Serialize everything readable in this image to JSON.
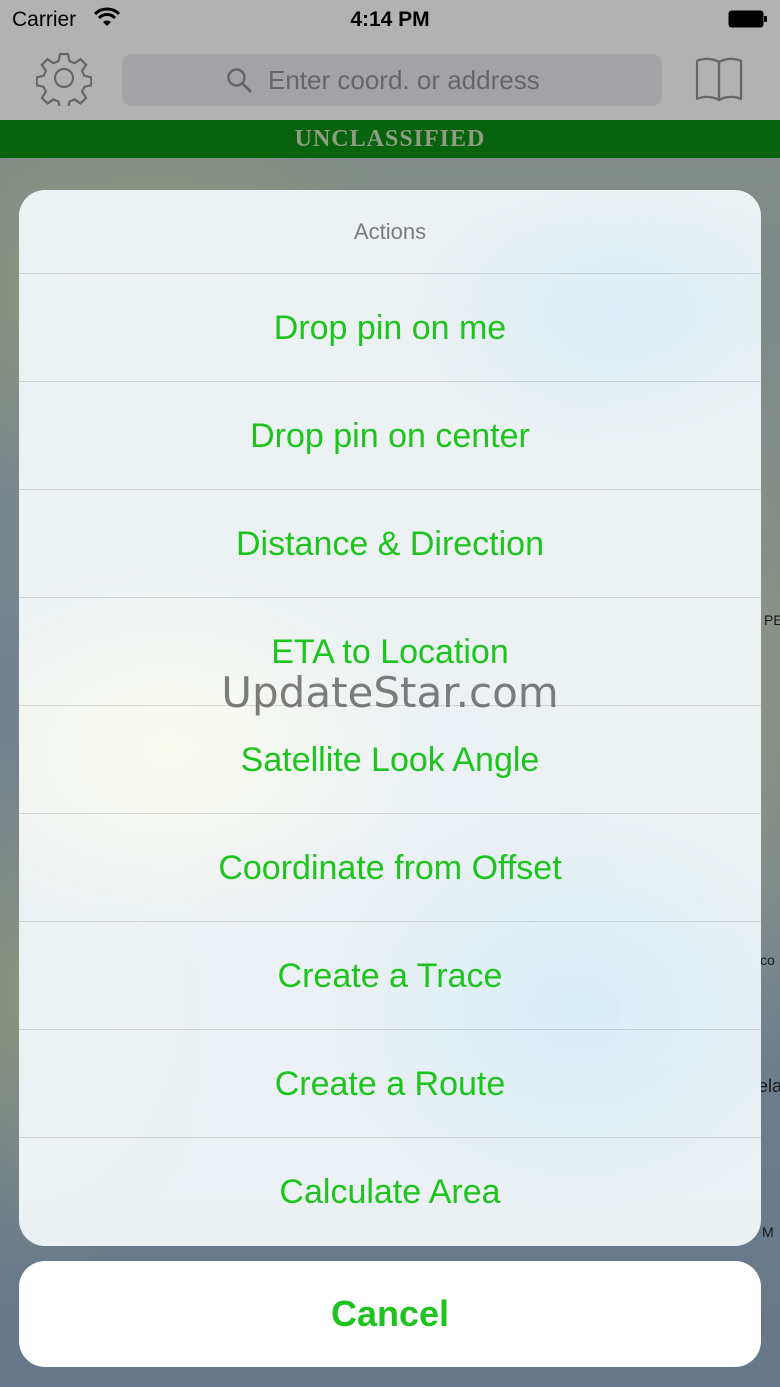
{
  "status_bar": {
    "carrier": "Carrier",
    "time": "4:14 PM",
    "wifi_icon": "wifi-icon",
    "battery_icon": "battery-full-icon"
  },
  "toolbar": {
    "settings_icon": "gear-icon",
    "search_icon": "magnifier-icon",
    "search_placeholder": "Enter coord. or address",
    "search_value": "",
    "bookmarks_icon": "book-icon"
  },
  "banner": {
    "text": "UNCLASSIFIED",
    "background": "#0a8a12",
    "text_color": "#c6d9b4"
  },
  "map": {
    "edge_labels": [
      "PE",
      "co",
      "ela",
      "M"
    ]
  },
  "action_sheet": {
    "title": "Actions",
    "accent_color": "#1ec41e",
    "actions": [
      "Drop pin on me",
      "Drop pin on center",
      "Distance & Direction",
      "ETA to Location",
      "Satellite Look Angle",
      "Coordinate from Offset",
      "Create a Trace",
      "Create a Route",
      "Calculate Area"
    ]
  },
  "cancel": {
    "label": "Cancel"
  },
  "watermark": {
    "text": "UpdateStar.com"
  }
}
